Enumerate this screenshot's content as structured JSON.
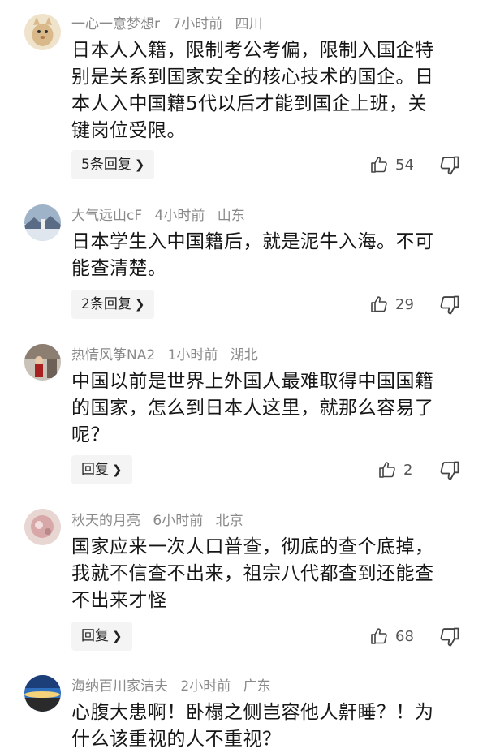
{
  "comments": [
    {
      "user": "一心一意梦想r",
      "time": "7小时前",
      "location": "四川",
      "lines": [
        "日本人入籍，限制考公考偏，限制入国企特",
        "别是关系到国家安全的核心技术的国企。日",
        "本人入中国籍5代以后才能到国企上班，关",
        "键岗位受限。"
      ],
      "reply_label": "5条回复",
      "likes": "54",
      "avatar_color": "#d9b98a"
    },
    {
      "user": "大气远山cF",
      "time": "4小时前",
      "location": "山东",
      "lines": [
        "日本学生入中国籍后，就是泥牛入海。不可",
        "能查清楚。"
      ],
      "reply_label": "2条回复",
      "likes": "29",
      "avatar_color": "#5a6b86"
    },
    {
      "user": "热情风筝NA2",
      "time": "1小时前",
      "location": "湖北",
      "lines": [
        "中国以前是世界上外国人最难取得中国国籍",
        "的国家，怎么到日本人这里，就那么容易了",
        "呢？"
      ],
      "reply_label": "回复",
      "likes": "2",
      "avatar_color": "#7a3a3a"
    },
    {
      "user": "秋天的月亮",
      "time": "6小时前",
      "location": "北京",
      "lines": [
        "国家应来一次人口普查，彻底的查个底掉，",
        "我就不信查不出来，祖宗八代都查到还能查",
        "不出来才怪"
      ],
      "reply_label": "回复",
      "likes": "68",
      "avatar_color": "#d8a8a8"
    },
    {
      "user": "海纳百川家洁夫",
      "time": "2小时前",
      "location": "广东",
      "lines": [
        "心腹大患啊！卧榻之侧岂容他人鼾睡？！为",
        "什么该重视的人不重视？"
      ],
      "reply_label": "",
      "likes": "",
      "avatar_color": "#2f6fc0"
    }
  ]
}
